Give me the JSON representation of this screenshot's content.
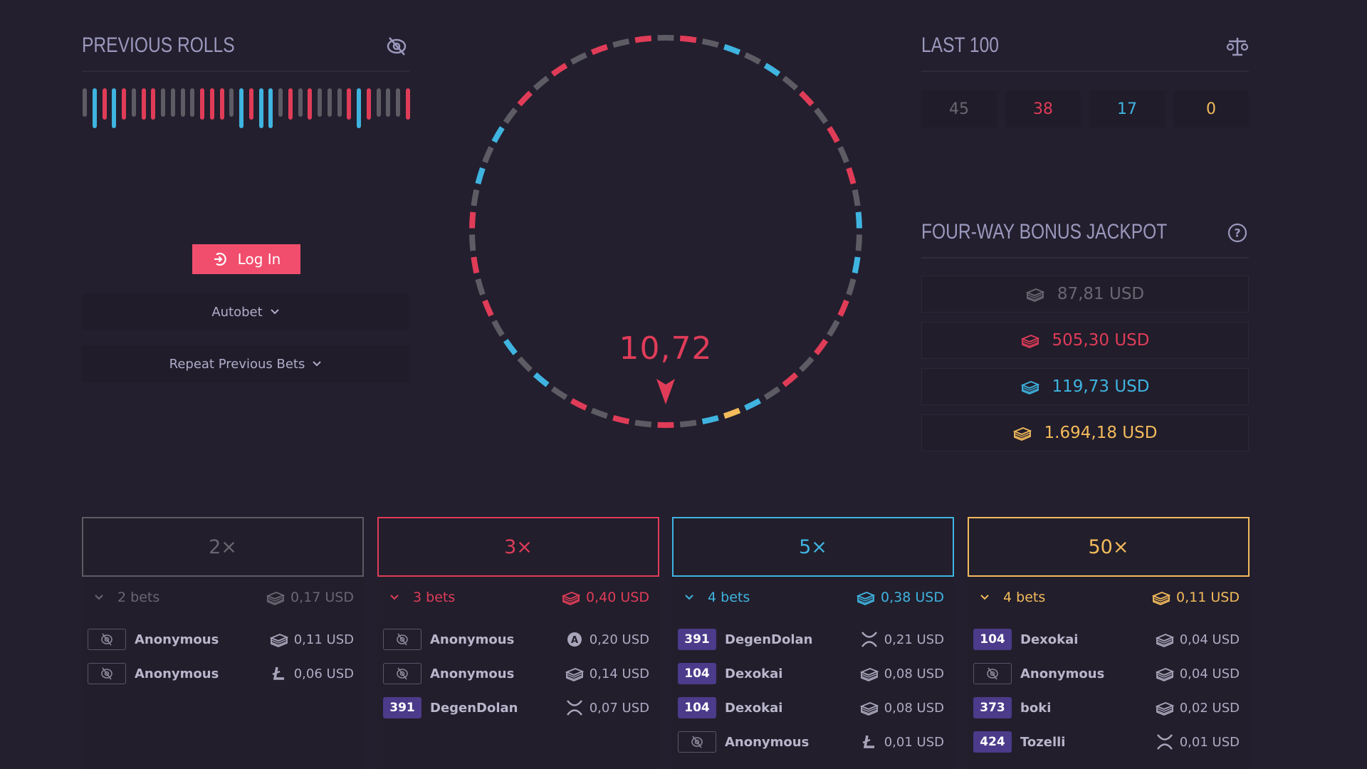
{
  "colors": {
    "gray": "#5d5b63",
    "red": "#e03c58",
    "blue": "#3fb4e0",
    "gold": "#f3bb5b",
    "gray_text": "#6a6772"
  },
  "previous_rolls": {
    "title": "PREVIOUS ROLLS",
    "hide_icon": "eye-off-icon",
    "rolls": [
      "gray",
      "blue",
      "red",
      "blue",
      "red",
      "gray",
      "red",
      "red",
      "gray",
      "gray",
      "gray",
      "gray",
      "red",
      "red",
      "red",
      "gray",
      "blue",
      "red",
      "blue",
      "blue",
      "gray",
      "red",
      "gray",
      "red",
      "gray",
      "gray",
      "gray",
      "red",
      "blue",
      "red",
      "gray",
      "gray",
      "gray",
      "red"
    ]
  },
  "controls": {
    "login_label": "Log In",
    "autobet_label": "Autobet",
    "repeat_label": "Repeat Previous Bets"
  },
  "wheel": {
    "result": "10,72",
    "segments": [
      "gray",
      "red",
      "gray",
      "blue",
      "gray",
      "blue",
      "gray",
      "red",
      "gray",
      "red",
      "gray",
      "red",
      "gray",
      "blue",
      "gray",
      "blue",
      "gray",
      "red",
      "gray",
      "red",
      "gray",
      "red",
      "gray",
      "blue",
      "gold",
      "blue",
      "gray",
      "red",
      "gray",
      "red",
      "gray",
      "red",
      "gray",
      "blue",
      "gray",
      "blue",
      "gray",
      "red",
      "gray",
      "red",
      "gray",
      "red",
      "gray",
      "blue",
      "gray",
      "blue",
      "gray",
      "red",
      "gray",
      "red",
      "gray",
      "red",
      "gray",
      "red"
    ]
  },
  "last100": {
    "title": "LAST 100",
    "icon": "scale-icon",
    "counts": [
      {
        "color": "gray",
        "value": "45"
      },
      {
        "color": "red",
        "value": "38"
      },
      {
        "color": "blue",
        "value": "17"
      },
      {
        "color": "gold",
        "value": "0"
      }
    ]
  },
  "jackpot": {
    "title": "FOUR-WAY BONUS JACKPOT",
    "help_icon": "help-circle-icon",
    "rows": [
      {
        "color": "gray",
        "amount": "87,81 USD"
      },
      {
        "color": "red",
        "amount": "505,30 USD"
      },
      {
        "color": "blue",
        "amount": "119,73 USD"
      },
      {
        "color": "gold",
        "amount": "1.694,18 USD"
      }
    ]
  },
  "bet_columns": [
    {
      "multiplier": "2×",
      "color": "gray",
      "bets_label": "2 bets",
      "total": "0,17 USD",
      "bets": [
        {
          "badge": "anon",
          "name": "Anonymous",
          "coin": "cash",
          "amount": "0,11 USD"
        },
        {
          "badge": "anon",
          "name": "Anonymous",
          "coin": "ltc",
          "amount": "0,06 USD"
        }
      ]
    },
    {
      "multiplier": "3×",
      "color": "red",
      "bets_label": "3 bets",
      "total": "0,40 USD",
      "bets": [
        {
          "badge": "anon",
          "name": "Anonymous",
          "coin": "ada",
          "amount": "0,20 USD"
        },
        {
          "badge": "anon",
          "name": "Anonymous",
          "coin": "cash",
          "amount": "0,14 USD"
        },
        {
          "badge": "391",
          "name": "DegenDolan",
          "coin": "xrp",
          "amount": "0,07 USD"
        }
      ]
    },
    {
      "multiplier": "5×",
      "color": "blue",
      "bets_label": "4 bets",
      "total": "0,38 USD",
      "bets": [
        {
          "badge": "391",
          "name": "DegenDolan",
          "coin": "xrp",
          "amount": "0,21 USD"
        },
        {
          "badge": "104",
          "name": "Dexokai",
          "coin": "cash",
          "amount": "0,08 USD"
        },
        {
          "badge": "104",
          "name": "Dexokai",
          "coin": "cash",
          "amount": "0,08 USD"
        },
        {
          "badge": "anon",
          "name": "Anonymous",
          "coin": "ltc",
          "amount": "0,01 USD"
        }
      ]
    },
    {
      "multiplier": "50×",
      "color": "gold",
      "bets_label": "4 bets",
      "total": "0,11 USD",
      "bets": [
        {
          "badge": "104",
          "name": "Dexokai",
          "coin": "cash",
          "amount": "0,04 USD"
        },
        {
          "badge": "anon",
          "name": "Anonymous",
          "coin": "cash",
          "amount": "0,04 USD"
        },
        {
          "badge": "373",
          "name": "boki",
          "coin": "cash",
          "amount": "0,02 USD"
        },
        {
          "badge": "424",
          "name": "Tozelli",
          "coin": "xrp",
          "amount": "0,01 USD"
        }
      ]
    }
  ]
}
